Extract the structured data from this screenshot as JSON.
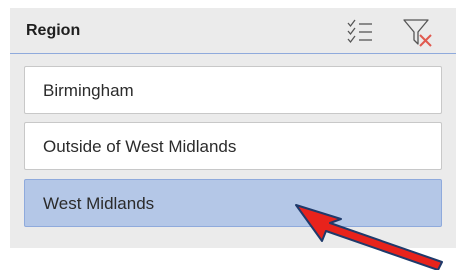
{
  "slicer": {
    "title": "Region",
    "icons": {
      "multiselect": "multiselect-checklist-icon",
      "clear": "clear-filter-icon"
    },
    "items": [
      {
        "label": "Birmingham",
        "selected": false
      },
      {
        "label": "Outside of West Midlands",
        "selected": false
      },
      {
        "label": "West Midlands",
        "selected": true
      }
    ]
  },
  "colors": {
    "selected_fill": "#b4c7e7",
    "header_rule": "#8faadc",
    "clear_icon_x": "#e05a4f",
    "annotation_arrow": "#e8231c"
  },
  "annotation": {
    "icon": "pointer-arrow",
    "target": "West Midlands"
  }
}
